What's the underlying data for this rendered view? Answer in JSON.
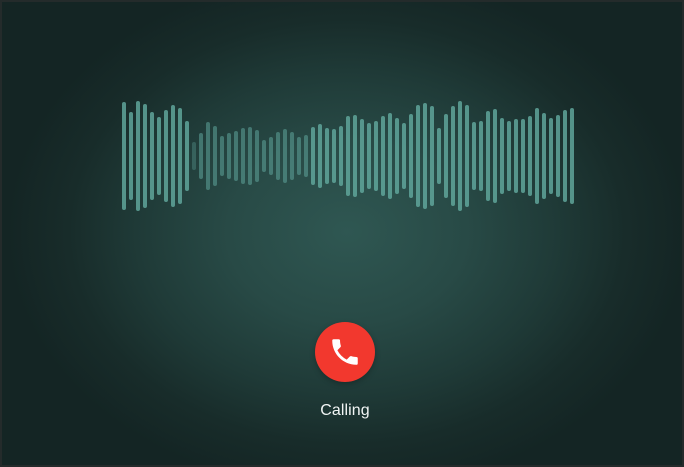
{
  "call": {
    "status": "Calling",
    "end_button_icon": "phone-icon"
  },
  "colors": {
    "end_button": "#f2382e",
    "waveform_bar": "#5fa49a",
    "background_center": "#2f5752",
    "background_edge": "#142524"
  },
  "waveform": {
    "bar_count": 65
  }
}
